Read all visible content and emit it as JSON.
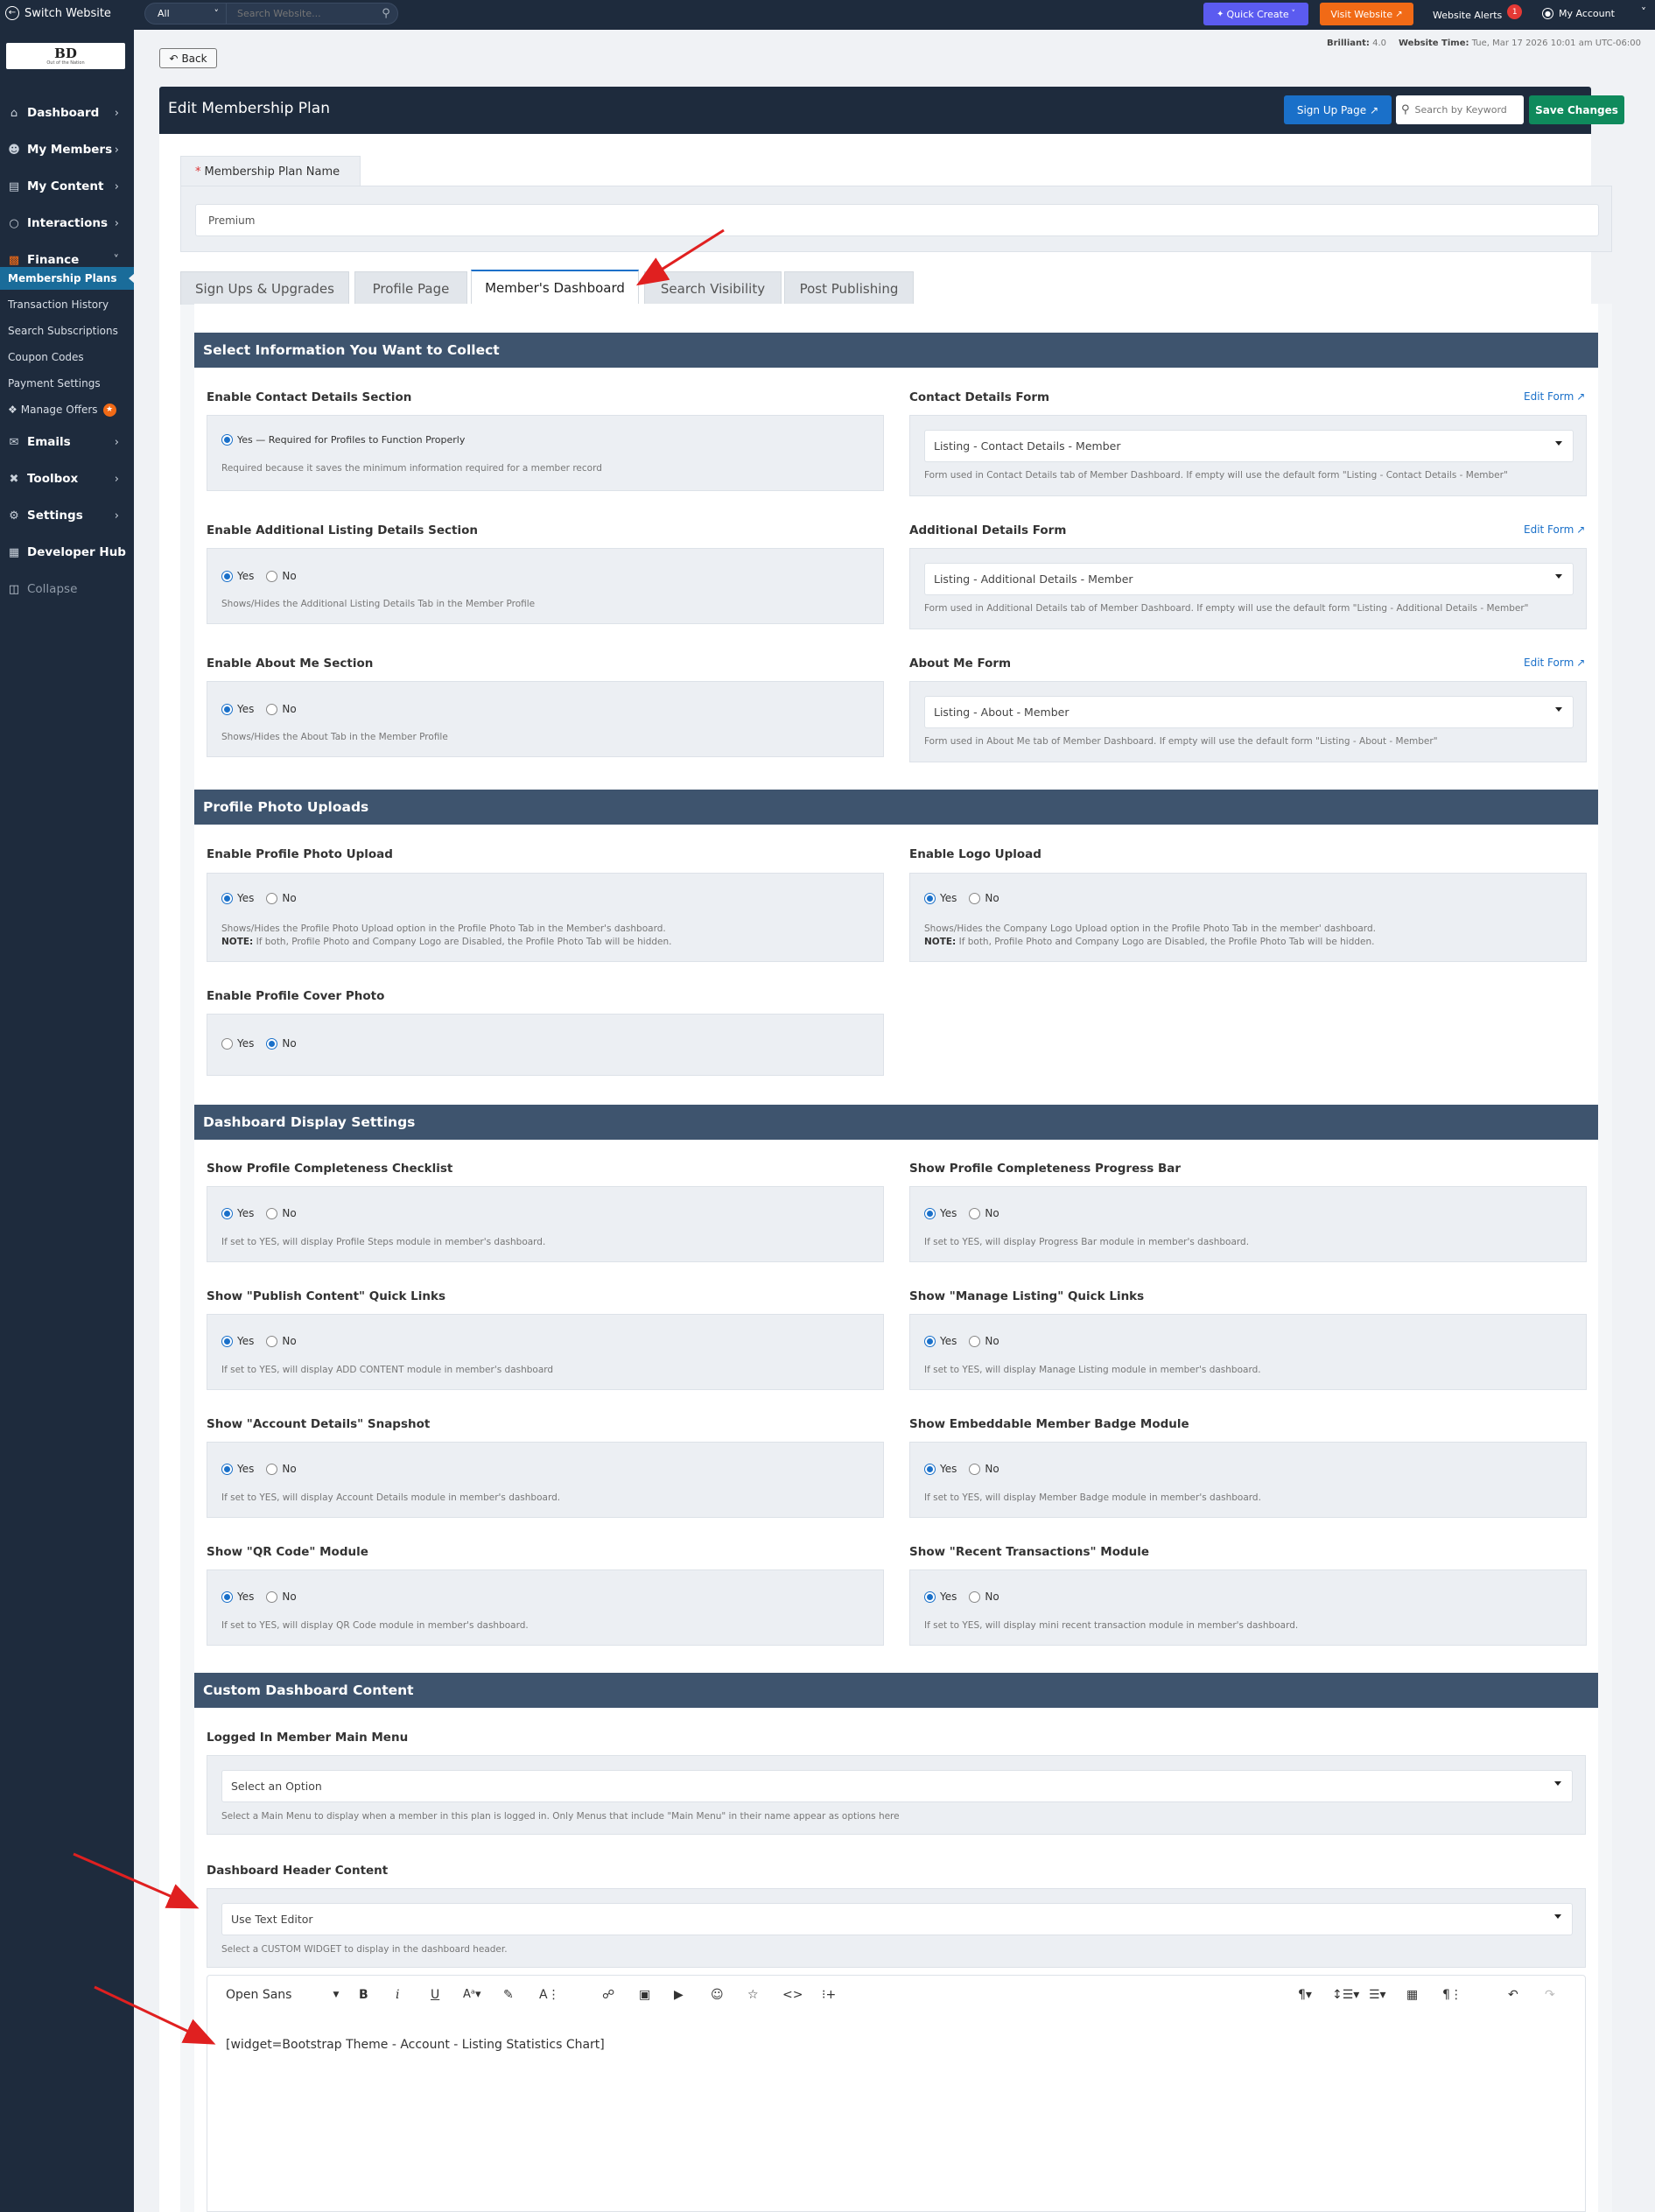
{
  "topbar": {
    "switch_website": "Switch Website",
    "search_category": "All",
    "search_placeholder": "Search Website...",
    "quick_create": "Quick Create",
    "visit_website": "Visit Website",
    "website_alerts": "Website Alerts",
    "alerts_count": "1",
    "my_account": "My Account"
  },
  "sidebar": {
    "logo_text": "BD",
    "logo_subtext": "Out of the Nation",
    "items": [
      {
        "label": "Dashboard"
      },
      {
        "label": "My Members"
      },
      {
        "label": "My Content"
      },
      {
        "label": "Interactions"
      },
      {
        "label": "Finance"
      }
    ],
    "finance_sub": [
      {
        "label": "Membership Plans"
      },
      {
        "label": "Transaction History"
      },
      {
        "label": "Search Subscriptions"
      },
      {
        "label": "Coupon Codes"
      },
      {
        "label": "Payment Settings"
      },
      {
        "label": "Manage Offers"
      }
    ],
    "items2": [
      {
        "label": "Emails"
      },
      {
        "label": "Toolbox"
      },
      {
        "label": "Settings"
      },
      {
        "label": "Developer Hub"
      },
      {
        "label": "Collapse"
      }
    ]
  },
  "header": {
    "back": "Back",
    "brilliant_label": "Brilliant:",
    "brilliant_value": "4.0",
    "time_label": "Website Time:",
    "time_value": "Tue, Mar 17 2026 10:01 am UTC-06:00",
    "title": "Edit Membership Plan",
    "signup_page": "Sign Up Page",
    "search_placeholder": "Search by Keyword",
    "save": "Save Changes"
  },
  "plan": {
    "required_mark": "*",
    "label": "Membership Plan Name",
    "value": "Premium"
  },
  "tabs": [
    {
      "label": "Sign Ups & Upgrades"
    },
    {
      "label": "Profile Page"
    },
    {
      "label": "Member's Dashboard"
    },
    {
      "label": "Search Visibility"
    },
    {
      "label": "Post Publishing"
    }
  ],
  "sections": {
    "collect": "Select Information You Want to Collect",
    "photos": "Profile Photo Uploads",
    "display": "Dashboard Display Settings",
    "custom": "Custom Dashboard Content"
  },
  "labels": {
    "yes": "Yes",
    "no": "No",
    "edit_form": "Edit Form",
    "note": "NOTE:"
  },
  "fields": {
    "contact_section": {
      "label": "Enable Contact Details Section",
      "yes_note": "Yes — Required for Profiles to Function Properly",
      "help": "Required because it saves the minimum information required for a member record"
    },
    "contact_form": {
      "label": "Contact Details Form",
      "value": "Listing - Contact Details - Member",
      "help": "Form used in Contact Details tab of Member Dashboard. If empty will use the default form \"Listing - Contact Details - Member\""
    },
    "additional_section": {
      "label": "Enable Additional Listing Details Section",
      "help": "Shows/Hides the Additional Listing Details Tab in the Member Profile"
    },
    "additional_form": {
      "label": "Additional Details Form",
      "value": "Listing - Additional Details - Member",
      "help": "Form used in Additional Details tab of Member Dashboard. If empty will use the default form \"Listing - Additional Details - Member\""
    },
    "about_section": {
      "label": "Enable About Me Section",
      "help": "Shows/Hides the About Tab in the Member Profile"
    },
    "about_form": {
      "label": "About Me Form",
      "value": "Listing - About - Member",
      "help": "Form used in About Me tab of Member Dashboard. If empty will use the default form \"Listing - About - Member\""
    },
    "photo_upload": {
      "label": "Enable Profile Photo Upload",
      "help": "Shows/Hides the Profile Photo Upload option in the Profile Photo Tab in the Member's dashboard.",
      "note": "If both, Profile Photo and Company Logo are Disabled, the Profile Photo Tab will be hidden."
    },
    "logo_upload": {
      "label": "Enable Logo Upload",
      "help": "Shows/Hides the Company Logo Upload option in the Profile Photo Tab in the member' dashboard.",
      "note": "If both, Profile Photo and Company Logo are Disabled, the Profile Photo Tab will be hidden."
    },
    "cover_photo": {
      "label": "Enable Profile Cover Photo"
    },
    "checklist": {
      "label": "Show Profile Completeness Checklist",
      "help": "If set to YES, will display Profile Steps module in member's dashboard."
    },
    "progress_bar": {
      "label": "Show Profile Completeness Progress Bar",
      "help": "If set to YES, will display Progress Bar module in member's dashboard."
    },
    "publish_links": {
      "label": "Show \"Publish Content\" Quick Links",
      "help": "If set to YES, will display ADD CONTENT module in member's dashboard"
    },
    "manage_links": {
      "label": "Show \"Manage Listing\" Quick Links",
      "help": "If set to YES, will display Manage Listing module in member's dashboard."
    },
    "account_snapshot": {
      "label": "Show \"Account Details\" Snapshot",
      "help": "If set to YES, will display Account Details module in member's dashboard."
    },
    "badge_module": {
      "label": "Show Embeddable Member Badge Module",
      "help": "If set to YES, will display Member Badge module in member's dashboard."
    },
    "qr_module": {
      "label": "Show \"QR Code\" Module",
      "help": "If set to YES, will display QR Code module in member's dashboard."
    },
    "transactions_module": {
      "label": "Show \"Recent Transactions\" Module",
      "help": "If set to YES, will display mini recent transaction module in member's dashboard."
    },
    "main_menu": {
      "label": "Logged In Member Main Menu",
      "value": "Select an Option",
      "help": "Select a Main Menu to display when a member in this plan is logged in. Only Menus that include \"Main Menu\" in their name appear as options here"
    },
    "header_content": {
      "label": "Dashboard Header Content",
      "value": "Use Text Editor",
      "help": "Select a CUSTOM WIDGET to display in the dashboard header."
    }
  },
  "editor": {
    "font": "Open Sans",
    "content": "[widget=Bootstrap Theme - Account - Listing Statistics Chart]"
  }
}
